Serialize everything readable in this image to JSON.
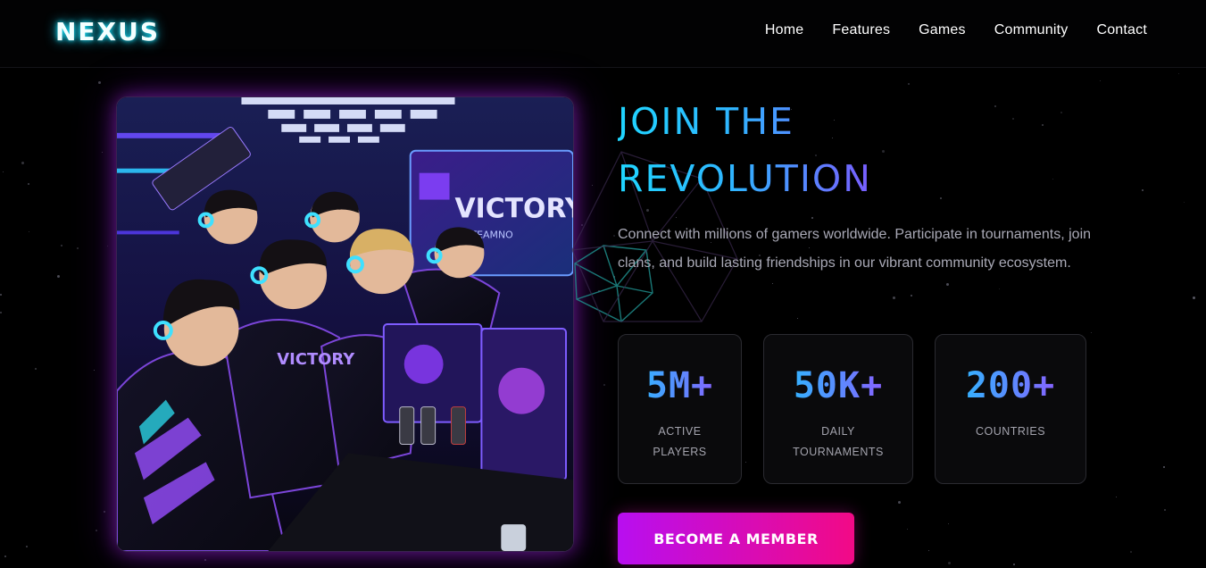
{
  "header": {
    "logo": "NEXUS",
    "nav": [
      "Home",
      "Features",
      "Games",
      "Community",
      "Contact"
    ]
  },
  "hero": {
    "image_text": {
      "screen_title": "VICTORY",
      "screen_subtitle": "TEAMNO",
      "jersey_text": "VICTORY"
    },
    "headline_line1": "JOIN THE",
    "headline_line2": "REVOLUTION",
    "description": "Connect with millions of gamers worldwide. Participate in tournaments, join clans, and build lasting friendships in our vibrant community ecosystem.",
    "stats": [
      {
        "value": "5M+",
        "label_line1": "ACTIVE",
        "label_line2": "PLAYERS"
      },
      {
        "value": "50K+",
        "label_line1": "DAILY",
        "label_line2": "TOURNAMENTS"
      },
      {
        "value": "200+",
        "label_line1": "COUNTRIES",
        "label_line2": ""
      }
    ],
    "cta_label": "BECOME A MEMBER"
  },
  "colors": {
    "background": "#000000",
    "logo_glow": "#18e6ff",
    "headline_gradient": [
      "#1fd6ff",
      "#7a5cff"
    ],
    "stat_gradient": [
      "#1ec8ff",
      "#a347ff"
    ],
    "cta_gradient": [
      "#b80ef0",
      "#f20a86"
    ]
  }
}
